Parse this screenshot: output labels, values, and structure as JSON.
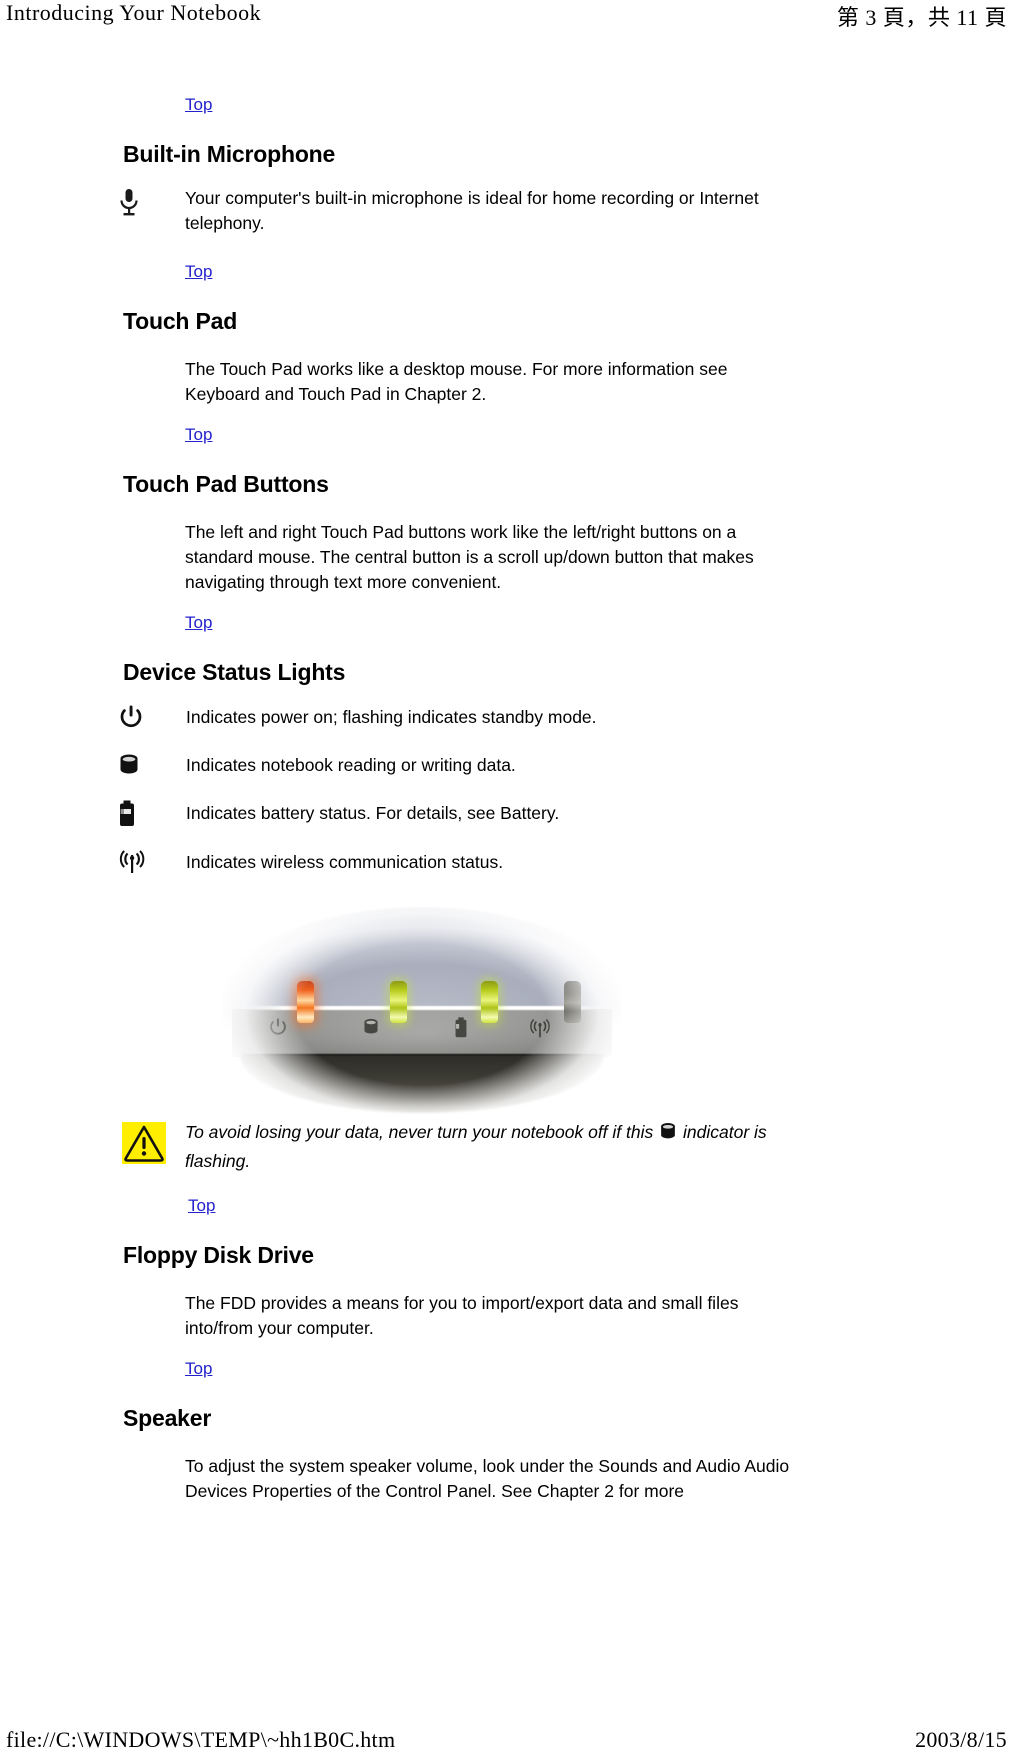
{
  "header": {
    "title": "Introducing Your Notebook",
    "page_info": "第 3 頁，共 11 頁"
  },
  "links": {
    "top_label": "Top"
  },
  "sections": [
    {
      "id": "built-in-microphone",
      "heading": "Built-in Microphone",
      "icon": "microphone-icon",
      "text": "Your computer's built-in microphone is ideal for home recording or Internet telephony."
    },
    {
      "id": "touch-pad",
      "heading": "Touch Pad",
      "text": "The Touch Pad works like a desktop mouse. For more information see Keyboard and Touch Pad in Chapter 2."
    },
    {
      "id": "touch-pad-buttons",
      "heading": "Touch Pad Buttons",
      "text": "The left and right Touch Pad buttons work like the left/right buttons on a standard mouse. The central button is a scroll up/down button that makes navigating through text more convenient."
    },
    {
      "id": "device-status-lights",
      "heading": "Device Status Lights",
      "rows": [
        {
          "icon": "power-icon",
          "text": "Indicates power on; flashing indicates standby mode."
        },
        {
          "icon": "hard-disk-icon",
          "text": "Indicates notebook reading or writing data."
        },
        {
          "icon": "battery-icon",
          "text": "Indicates battery status. For details, see Battery."
        },
        {
          "icon": "wireless-icon",
          "text": "Indicates wireless communication status."
        }
      ],
      "figure": {
        "name": "status-lights-photo",
        "alt": "Photograph of notebook front edge showing four status indicator LEDs",
        "leds": [
          {
            "name": "power-led",
            "state": "on",
            "color": "#f4761f"
          },
          {
            "name": "hdd-led",
            "state": "on",
            "color": "#c8dd2b"
          },
          {
            "name": "battery-led",
            "state": "on",
            "color": "#c8dd2b"
          },
          {
            "name": "wireless-led",
            "state": "off",
            "color": "#4d4b42"
          }
        ]
      },
      "note": {
        "icon": "warning-icon",
        "text_before": "To avoid losing your data, never turn your notebook off if this",
        "inline_icon": "hard-disk-icon",
        "text_after": "indicator is flashing."
      }
    },
    {
      "id": "floppy-disk-drive",
      "heading": "Floppy Disk Drive",
      "text": "The FDD provides a means for you to import/export data and small files into/from your computer."
    },
    {
      "id": "speaker",
      "heading": "Speaker",
      "text": "To adjust the system speaker volume, look under the Sounds and Audio Audio Devices Properties of the Control Panel. See Chapter 2 for more"
    }
  ],
  "footer": {
    "file_path": "file://C:\\WINDOWS\\TEMP\\~hh1B0C.htm",
    "date": "2003/8/15"
  },
  "colors": {
    "link": "#2222cc",
    "warning_bg": "#ffee00",
    "text": "#000000",
    "page_bg": "#ffffff"
  }
}
